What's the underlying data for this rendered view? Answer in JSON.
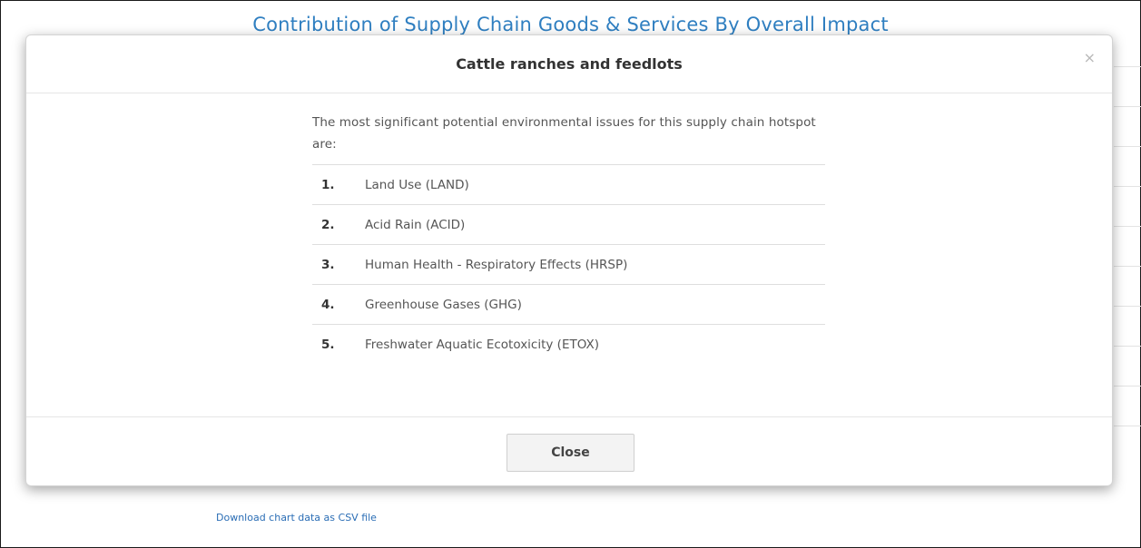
{
  "background": {
    "chart_title": "Contribution of Supply Chain Goods & Services By Overall Impact",
    "download_link": "Download chart data as CSV file"
  },
  "modal": {
    "title": "Cattle ranches and feedlots",
    "close_icon": "×",
    "intro": "The most significant potential environmental issues for this supply chain hotspot are:",
    "issues": [
      {
        "num": "1.",
        "label": "Land Use (LAND)"
      },
      {
        "num": "2.",
        "label": "Acid Rain (ACID)"
      },
      {
        "num": "3.",
        "label": "Human Health - Respiratory Effects (HRSP)"
      },
      {
        "num": "4.",
        "label": "Greenhouse Gases (GHG)"
      },
      {
        "num": "5.",
        "label": "Freshwater Aquatic Ecotoxicity (ETOX)"
      }
    ],
    "close_button": "Close"
  },
  "colors": {
    "title_blue": "#2f7fc1",
    "link_blue": "#2a6db5",
    "button_bg": "#f3f3f3"
  }
}
